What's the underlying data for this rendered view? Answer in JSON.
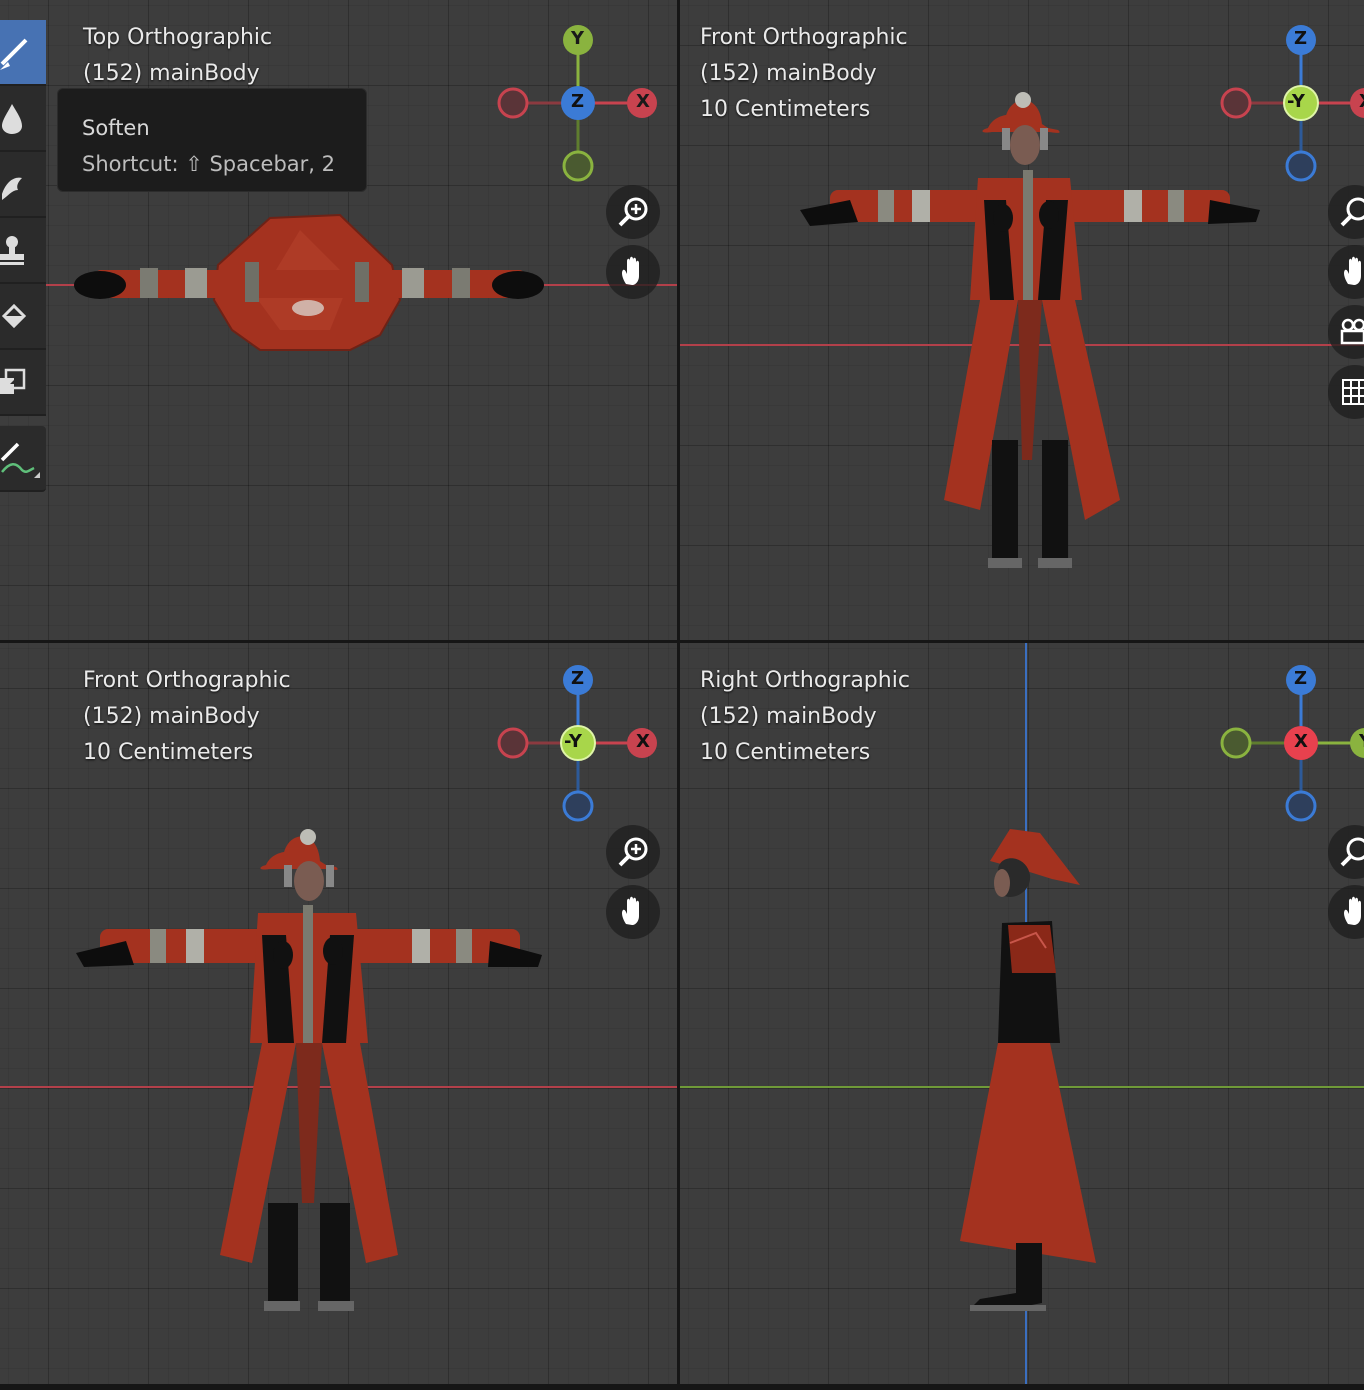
{
  "viewports": {
    "top_left": {
      "view": "Top Orthographic",
      "object": "(152) mainBody"
    },
    "top_right": {
      "view": "Front Orthographic",
      "object": "(152) mainBody",
      "scale": "10 Centimeters"
    },
    "bottom_left": {
      "view": "Front Orthographic",
      "object": "(152) mainBody",
      "scale": "10 Centimeters"
    },
    "bottom_right": {
      "view": "Right Orthographic",
      "object": "(152) mainBody",
      "scale": "10 Centimeters"
    }
  },
  "gizmos": {
    "top_left": {
      "top": "Y",
      "center": "Z",
      "right": "X"
    },
    "top_right": {
      "top": "Z",
      "center": "-Y",
      "right": "X"
    },
    "bottom_left": {
      "top": "Z",
      "center": "-Y",
      "right": "X"
    },
    "bottom_right": {
      "top": "Z",
      "center": "X",
      "right": "Y"
    }
  },
  "tooltip": {
    "title": "Soften",
    "shortcut": "Shortcut: ⇧ Spacebar, 2"
  },
  "toolbar": {
    "tools": [
      "draw-brush-icon",
      "soften-drop-icon",
      "smear-icon",
      "clone-stamp-icon",
      "fill-bucket-icon",
      "mask-icon",
      "annotate-icon"
    ],
    "active": "draw-brush-icon"
  },
  "colors": {
    "x_axis": "#c8434f",
    "y_axis": "#8ab33f",
    "z_axis": "#3b7bd6",
    "cloak": "#a4321f",
    "grid_bg": "#3d3d3d"
  }
}
